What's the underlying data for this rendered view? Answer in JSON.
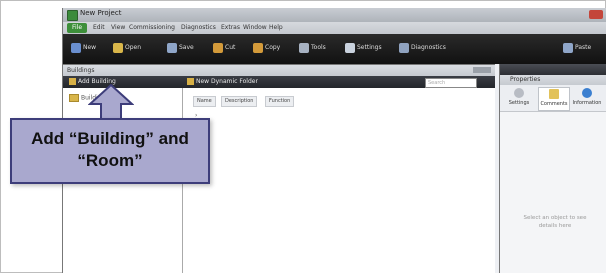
{
  "window": {
    "title": "New Project"
  },
  "menubar": {
    "file_label": "File",
    "items": [
      "Edit",
      "View",
      "Commissioning",
      "Diagnostics",
      "Extras",
      "Window",
      "Help"
    ]
  },
  "toolbar": {
    "buttons": [
      "New",
      "Open",
      "Save",
      "Cut",
      "Copy",
      "Paste",
      "Tools",
      "Settings",
      "Diagnostics"
    ]
  },
  "buildings_pane": {
    "title": "Buildings",
    "add_building_label": "Add Building",
    "new_dynamic_folder_label": "New Dynamic Folder",
    "search_placeholder": "Search",
    "tree_root_label": "Building",
    "columns": [
      "Name",
      "Description",
      "Function"
    ]
  },
  "properties_pane": {
    "title": "Properties",
    "tabs": [
      "Settings",
      "Comments",
      "Information"
    ],
    "empty_hint": "Select an object to see details here"
  },
  "callout": {
    "line1": "Add “Building” and",
    "line2": "“Room”"
  },
  "colors": {
    "callout_fill": "#a9a8ce",
    "callout_border": "#3d3d7a",
    "toolbar_bg": "#1a1a1a",
    "file_green": "#3d8f3a"
  }
}
